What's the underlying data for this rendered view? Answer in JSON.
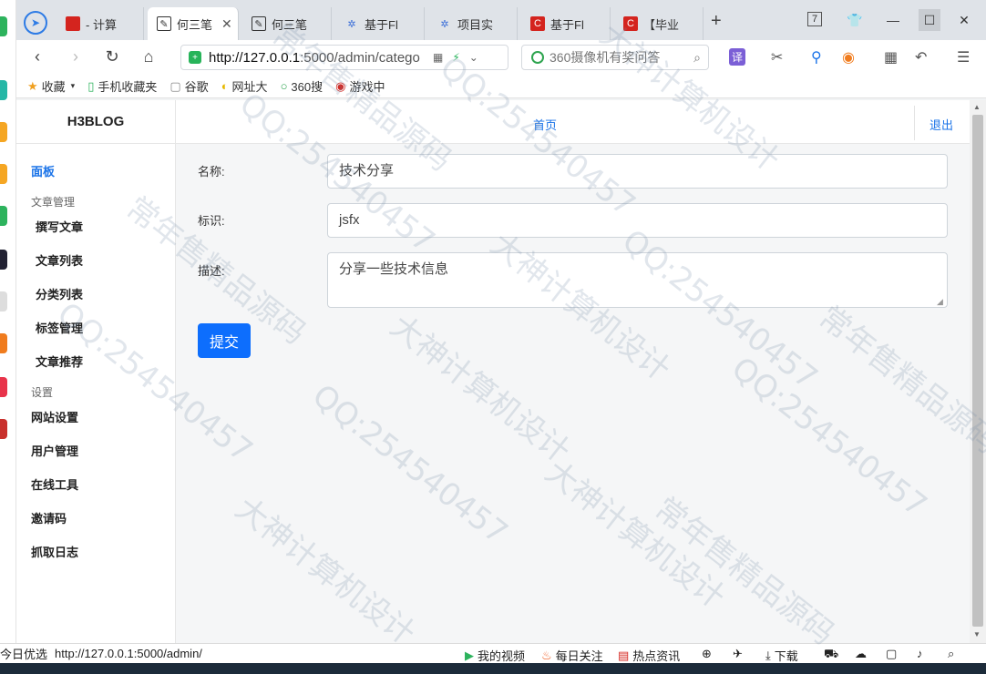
{
  "browser": {
    "tabs": [
      {
        "label": "- 计算",
        "icon_color": "#d4241e"
      },
      {
        "label": "何三笔",
        "icon_color": "#333333",
        "active": true
      },
      {
        "label": "何三笔",
        "icon_color": "#333333"
      },
      {
        "label": "基于Fl",
        "icon_color": "#3b6fd8"
      },
      {
        "label": "项目实",
        "icon_color": "#3b6fd8"
      },
      {
        "label": "基于Fl",
        "icon_color": "#d4241e"
      },
      {
        "label": "【毕业",
        "icon_color": "#d4241e"
      }
    ],
    "tab_counter": "7",
    "url_host": "http://127.0.0.1",
    "url_rest": ":5000/admin/catego",
    "search_placeholder": "360摄像机有奖问答",
    "bookmarks": [
      "收藏",
      "手机收藏夹",
      "谷歌",
      "网址大",
      "360搜",
      "游戏中"
    ]
  },
  "site": {
    "brand": "H3BLOG",
    "topnav": {
      "home": "首页",
      "logout": "退出"
    },
    "sidebar": {
      "dashboard": "面板",
      "section_articles": "文章管理",
      "article_items": [
        "撰写文章",
        "文章列表",
        "分类列表",
        "标签管理",
        "文章推荐"
      ],
      "section_settings": "设置",
      "settings_items": [
        "网站设置",
        "用户管理",
        "在线工具",
        "邀请码",
        "抓取日志"
      ]
    },
    "form": {
      "name_label": "名称:",
      "name_value": "技术分享",
      "slug_label": "标识:",
      "slug_value": "jsfx",
      "desc_label": "描述:",
      "desc_value": "分享一些技术信息",
      "submit_label": "提交"
    }
  },
  "statusbar": {
    "left_label": "今日优选",
    "hover_url": "http://127.0.0.1:5000/admin/",
    "items": [
      "我的视频",
      "每日关注",
      "热点资讯"
    ],
    "download_label": "下载"
  },
  "watermark": {
    "line_a": "大神计算机设计",
    "line_b": "QQ:254540457",
    "line_c": "常年售精品源码"
  }
}
